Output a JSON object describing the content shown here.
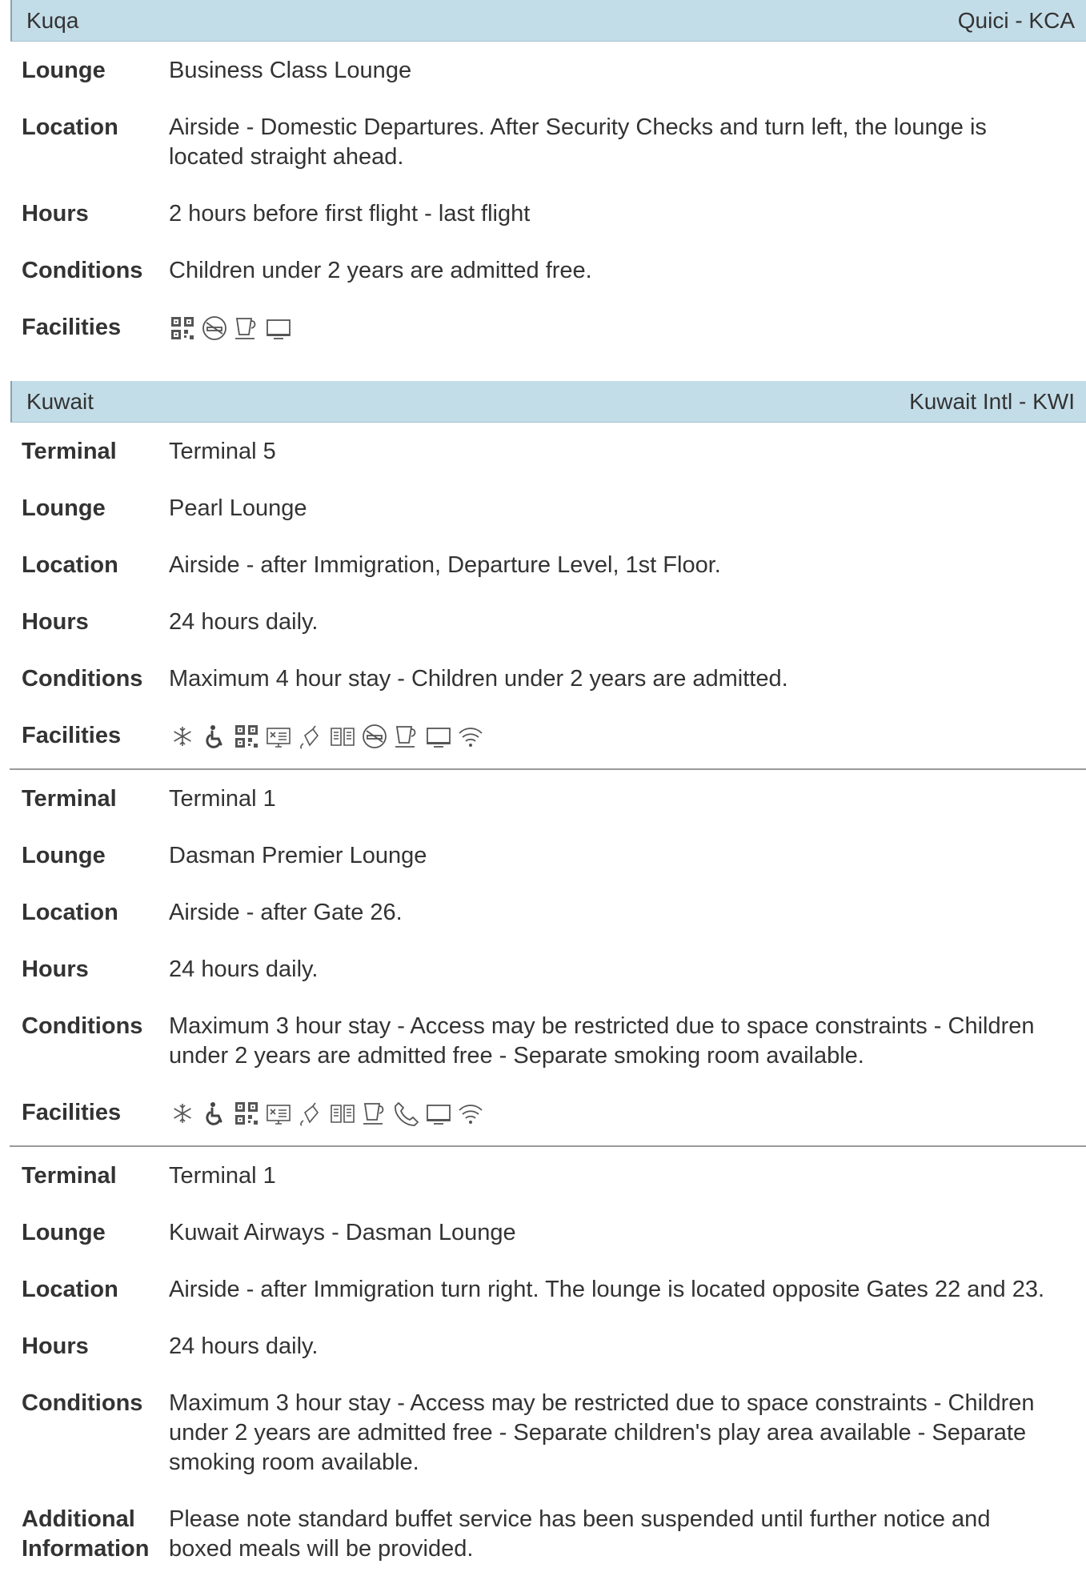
{
  "sections": [
    {
      "city": "Kuqa",
      "airport": "Quici - KCA",
      "lounges": [
        {
          "fields": [
            {
              "label": "Lounge",
              "value": "Business Class Lounge"
            },
            {
              "label": "Location",
              "value": "Airside - Domestic Departures. After Security Checks and turn left, the lounge is located straight ahead."
            },
            {
              "label": "Hours",
              "value": "2 hours before first flight - last flight"
            },
            {
              "label": "Conditions",
              "value": "Children under 2 years are admitted free."
            }
          ],
          "facilities_label": "Facilities",
          "facilities": [
            "flight-info-screen-icon",
            "no-smoking-icon",
            "refreshments-icon",
            "television-icon"
          ]
        }
      ]
    },
    {
      "city": "Kuwait",
      "airport": "Kuwait Intl - KWI",
      "lounges": [
        {
          "fields": [
            {
              "label": "Terminal",
              "value": "Terminal 5"
            },
            {
              "label": "Lounge",
              "value": "Pearl Lounge"
            },
            {
              "label": "Location",
              "value": "Airside - after Immigration, Departure Level, 1st Floor."
            },
            {
              "label": "Hours",
              "value": "24 hours daily."
            },
            {
              "label": "Conditions",
              "value": "Maximum 4 hour stay - Children under 2 years are admitted."
            }
          ],
          "facilities_label": "Facilities",
          "facilities": [
            "air-conditioning-icon",
            "disabled-access-icon",
            "flight-info-screen-icon",
            "conference-icon",
            "internet-icon",
            "newspapers-icon",
            "no-smoking-icon",
            "refreshments-icon",
            "television-icon",
            "wifi-icon"
          ]
        },
        {
          "fields": [
            {
              "label": "Terminal",
              "value": "Terminal 1"
            },
            {
              "label": "Lounge",
              "value": "Dasman Premier Lounge"
            },
            {
              "label": "Location",
              "value": "Airside - after Gate 26."
            },
            {
              "label": "Hours",
              "value": "24 hours daily."
            },
            {
              "label": "Conditions",
              "value": "Maximum 3 hour stay - Access may be restricted due to space constraints - Children under 2 years are admitted free - Separate smoking room available."
            }
          ],
          "facilities_label": "Facilities",
          "facilities": [
            "air-conditioning-icon",
            "disabled-access-icon",
            "flight-info-screen-icon",
            "conference-icon",
            "internet-icon",
            "newspapers-icon",
            "refreshments-icon",
            "telephone-icon",
            "television-icon",
            "wifi-icon"
          ]
        },
        {
          "fields": [
            {
              "label": "Terminal",
              "value": "Terminal 1"
            },
            {
              "label": "Lounge",
              "value": "Kuwait Airways - Dasman Lounge"
            },
            {
              "label": "Location",
              "value": "Airside - after Immigration turn right. The lounge is located opposite Gates 22 and 23."
            },
            {
              "label": "Hours",
              "value": "24 hours daily."
            },
            {
              "label": "Conditions",
              "value": "Maximum 3 hour stay - Access may be restricted due to space constraints - Children under 2 years are admitted free - Separate children's play area available - Separate smoking room available."
            },
            {
              "label": "Additional Information",
              "value": "Please note standard buffet service has been suspended until further notice and boxed meals will be provided."
            }
          ],
          "facilities_label": "",
          "facilities": []
        }
      ]
    }
  ]
}
